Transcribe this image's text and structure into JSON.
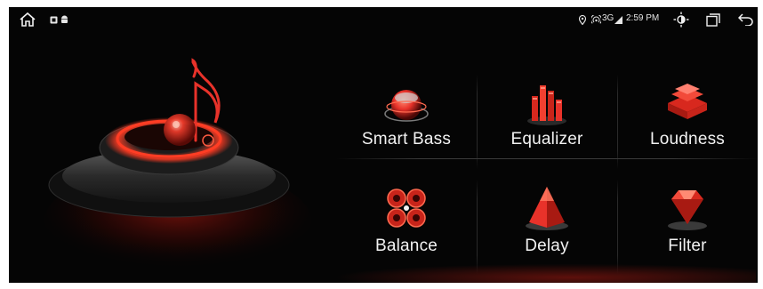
{
  "status_bar": {
    "network": "3G",
    "time": "2:59 PM",
    "icons": [
      "home-icon",
      "notification-app-icon",
      "android-icon",
      "location-icon",
      "hotspot-icon",
      "signal-icon",
      "brightness-icon",
      "recent-apps-icon",
      "back-icon"
    ]
  },
  "menu": {
    "items": [
      {
        "label": "Smart Bass",
        "icon": "smart-bass-icon"
      },
      {
        "label": "Equalizer",
        "icon": "equalizer-icon"
      },
      {
        "label": "Loudness",
        "icon": "loudness-icon"
      },
      {
        "label": "Balance",
        "icon": "balance-icon"
      },
      {
        "label": "Delay",
        "icon": "delay-icon"
      },
      {
        "label": "Filter",
        "icon": "filter-icon"
      }
    ]
  },
  "colors": {
    "accent": "#e8322a",
    "background": "#050505",
    "text": "#f2f2f2"
  }
}
